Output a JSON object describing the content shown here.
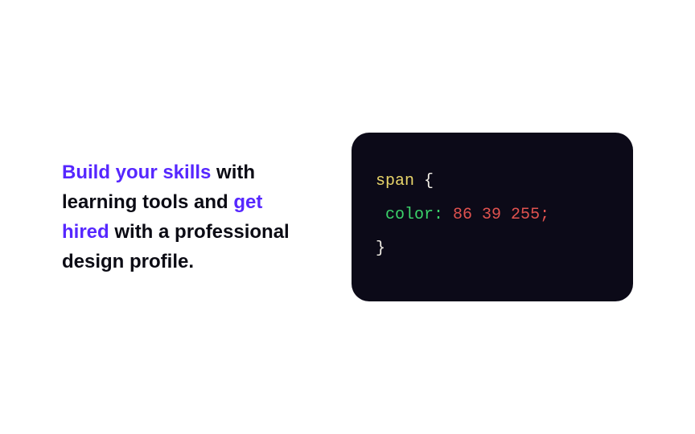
{
  "heading": {
    "part1_hl": "Build your skills",
    "part2": " with learning tools and ",
    "part3_hl": "get hired",
    "part4": " with a professional design profile."
  },
  "code": {
    "selector": "span",
    "brace_open": "{",
    "prop": "color",
    "colon": ":",
    "value": "86 39 255;",
    "brace_close": "}"
  }
}
